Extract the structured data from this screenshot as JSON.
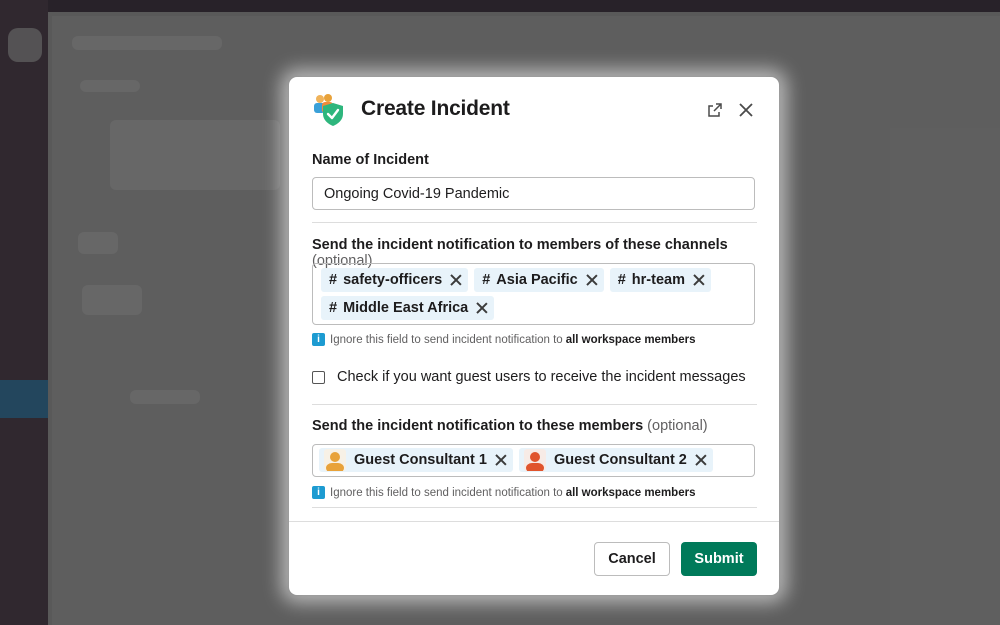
{
  "modal": {
    "title": "Create Incident",
    "popout_icon": "external-link-icon",
    "close_icon": "close-icon"
  },
  "incident_name": {
    "label": "Name of Incident",
    "value": "Ongoing Covid-19 Pandemic"
  },
  "channels": {
    "label": "Send the incident notification to members of these channels",
    "optional": "(optional)",
    "selected": [
      {
        "prefix": "#",
        "name": "safety-officers"
      },
      {
        "prefix": "#",
        "name": "Asia Pacific"
      },
      {
        "prefix": "#",
        "name": "hr-team"
      },
      {
        "prefix": "#",
        "name": "Middle East Africa"
      }
    ],
    "hint_prefix": "Ignore this field to send incident notification to",
    "hint_bold": "all workspace members"
  },
  "guest_checkbox": {
    "label": "Check if you want guest users to receive the incident messages",
    "checked": false
  },
  "members": {
    "label": "Send the incident notification to these members",
    "optional": "(optional)",
    "selected": [
      {
        "name": "Guest Consultant 1",
        "avatar_color": "#e8a23a"
      },
      {
        "name": "Guest Consultant 2",
        "avatar_color": "#e0542c"
      }
    ],
    "hint_prefix": "Ignore this field to send incident notification to",
    "hint_bold": "all workspace members"
  },
  "footer": {
    "cancel_label": "Cancel",
    "submit_label": "Submit"
  },
  "colors": {
    "submit_bg": "#007a5a",
    "chip_bg": "#e8f3fa",
    "info_icon": "#1d9bd1"
  }
}
